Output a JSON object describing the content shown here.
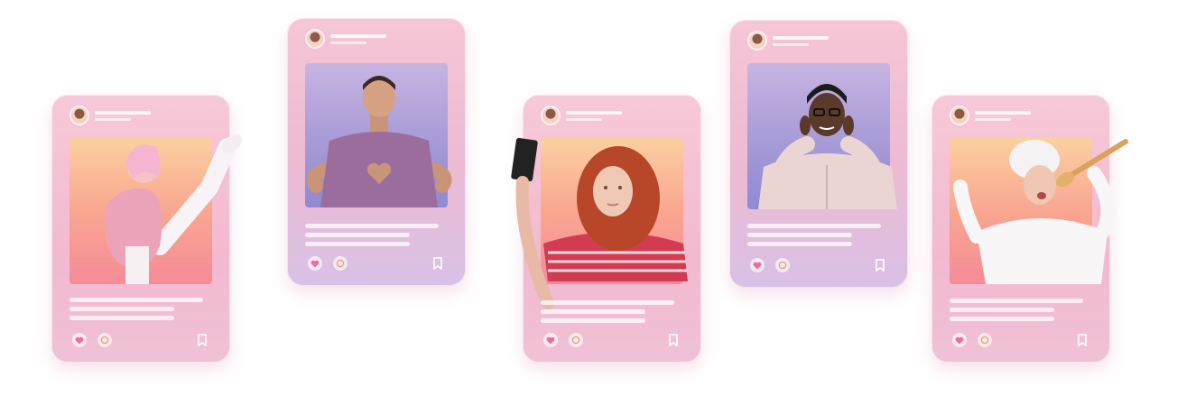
{
  "cards": [
    {
      "id": "card-1"
    },
    {
      "id": "card-2"
    },
    {
      "id": "card-3"
    },
    {
      "id": "card-4"
    },
    {
      "id": "card-5"
    }
  ],
  "colors": {
    "card_pink": "#f3b9cf",
    "photo_warm_top": "#fbd0a0",
    "photo_warm_bottom": "#f58b98",
    "photo_violet_top": "#c7b4e2",
    "photo_violet_bottom": "#8f8ad0",
    "heart": "#f06aa0",
    "comment": "#f7a070",
    "bookmark": "#ffffff"
  },
  "icons": [
    "heart-icon",
    "comment-icon",
    "bookmark-icon",
    "avatar"
  ]
}
